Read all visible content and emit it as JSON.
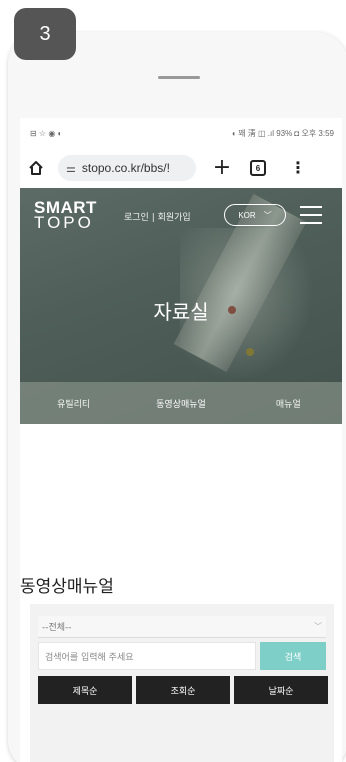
{
  "step_number": "3",
  "statusbar": {
    "left": "⊟ ☆ ◉ ◐",
    "right": "◖ 꽤 淸 ◫ .ıl 93% ◘ 오후 3:59"
  },
  "browser": {
    "url": "stopo.co.kr/bbs/!",
    "tabs_count": "6"
  },
  "site": {
    "logo_line1": "SMART",
    "logo_line2": "TOPO",
    "auth_links": "로그인 | 회원가입",
    "language": "KOR"
  },
  "hero": {
    "title": "자료실"
  },
  "subnav": {
    "items": [
      "유틸리티",
      "동영상매뉴얼",
      "매뉴얼"
    ]
  },
  "section": {
    "title": "동영상매뉴얼"
  },
  "search": {
    "select_value": "--전체--",
    "input_placeholder": "검색어를 입력해 주세요",
    "button_label": "검색",
    "sort_buttons": [
      "제목순",
      "조회순",
      "날짜순"
    ]
  },
  "colors": {
    "accent": "#7ecfc8",
    "hero_bg": "#55645f",
    "sort_button_bg": "#222222"
  }
}
